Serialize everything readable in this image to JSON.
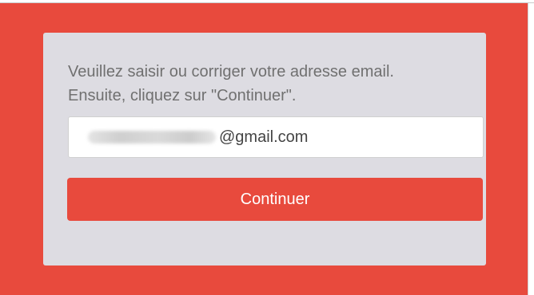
{
  "dialog": {
    "message_line1": "Veuillez saisir ou corriger votre adresse email.",
    "message_line2": "Ensuite, cliquez sur \"Continuer\"."
  },
  "email_field": {
    "domain_text": "@gmail.com"
  },
  "continue_button": {
    "label": "Continuer"
  },
  "colors": {
    "background": "#e84a3d",
    "card": "#dddce2",
    "button": "#e84a3d"
  }
}
